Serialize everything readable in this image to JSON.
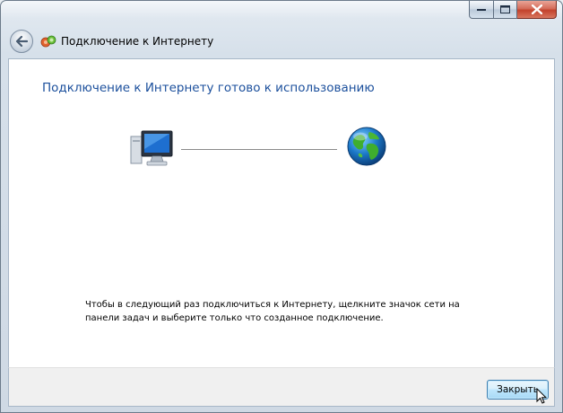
{
  "window": {
    "title": "Подключение к Интернету"
  },
  "caption": {
    "minimize_icon": "minimize-icon",
    "maximize_icon": "maximize-icon",
    "close_icon": "close-icon"
  },
  "main": {
    "heading": "Подключение к Интернету готово к использованию",
    "info_text": "Чтобы в следующий раз подключиться к Интернету, щелкните значок сети на панели задач и выберите только что созданное подключение."
  },
  "footer": {
    "close_label": "Закрыть"
  },
  "colors": {
    "heading": "#1b4f9c",
    "close_caption_button": "#c2422c",
    "default_button_border": "#3c7fb1"
  }
}
